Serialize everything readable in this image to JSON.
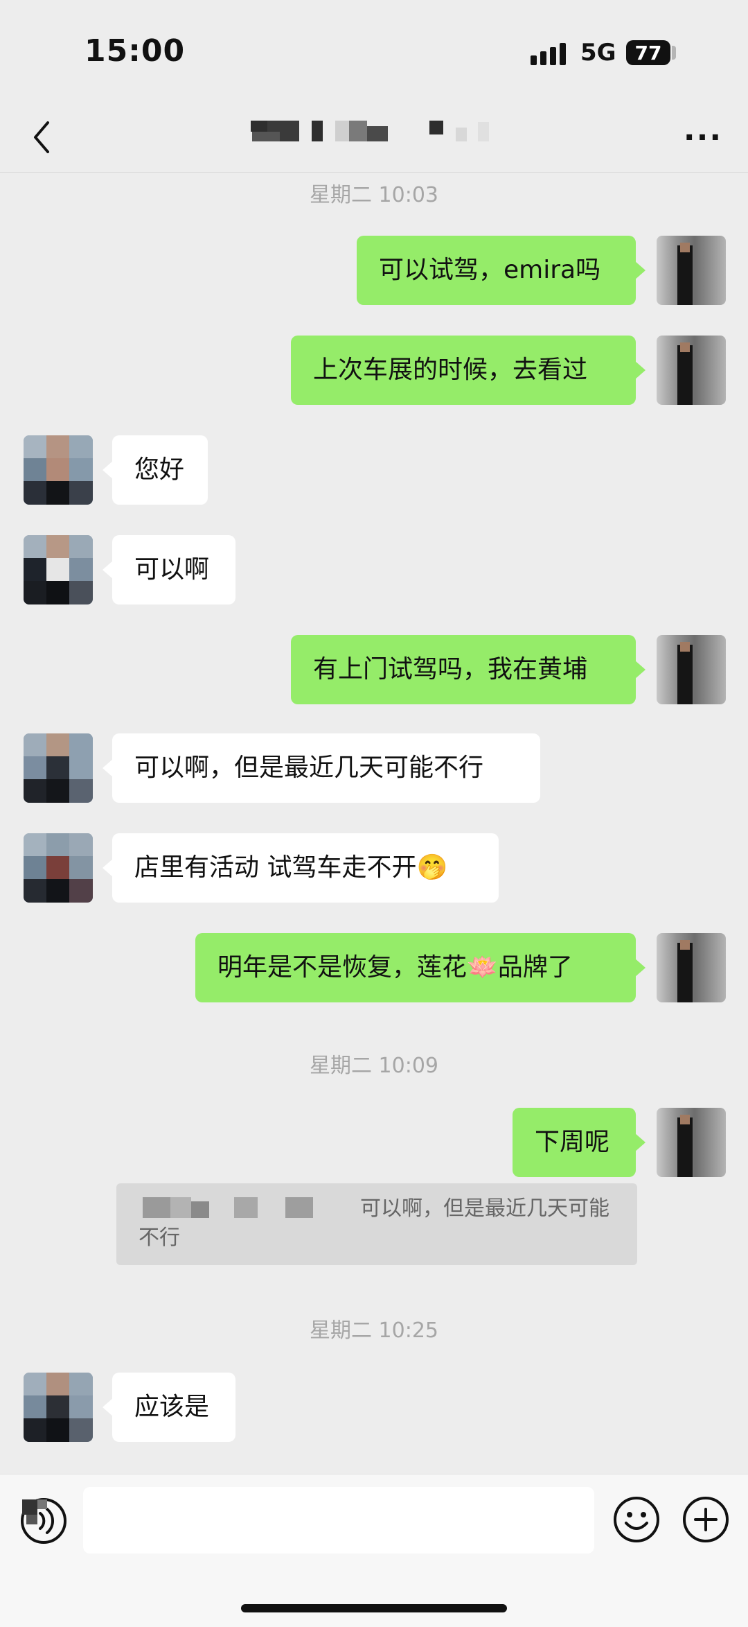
{
  "status_bar": {
    "time": "15:00",
    "network": "5G",
    "battery": "77"
  },
  "nav": {
    "title_obscured": true,
    "back_icon": "chevron-left-icon",
    "more_icon": "more-dots-icon",
    "more_label": "···"
  },
  "messages": {
    "ts1": "星期二 10:03",
    "m1": "可以试驾，emira吗",
    "m2": "上次车展的时候，去看过",
    "m3": "您好",
    "m4": "可以啊",
    "m5": "有上门试驾吗，我在黄埔",
    "m6": "可以啊，但是最近几天可能不行",
    "m7": "店里有活动 试驾车走不开",
    "m7_emoji": "🤭",
    "m8_a": "明年是不是恢复，莲花",
    "m8_emoji": "🪷",
    "m8_b": "品牌了",
    "ts2": "星期二 10:09",
    "m9": "下周呢",
    "quote": "可以啊，但是最近几天可能不行",
    "ts3": "星期二 10:25",
    "m10": "应该是"
  },
  "input_bar": {
    "voice_icon": "voice-icon",
    "emoji_icon": "emoji-icon",
    "plus_icon": "plus-icon",
    "placeholder": ""
  },
  "colors": {
    "background": "#ededed",
    "my_bubble": "#95ec69",
    "their_bubble": "#ffffff",
    "timestamp": "#a6a6a6"
  }
}
